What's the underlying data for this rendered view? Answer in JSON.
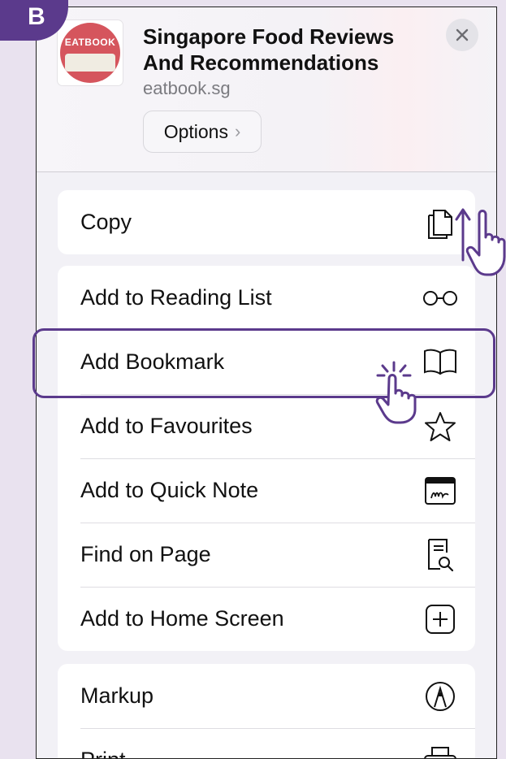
{
  "step_badge": "B",
  "site": {
    "title": "Singapore Food Reviews And Recommendations",
    "domain": "eatbook.sg",
    "logo_text": "EATBOOK",
    "options_label": "Options",
    "options_chevron": "›"
  },
  "groups": [
    {
      "rows": [
        {
          "label": "Copy",
          "icon": "copy-icon"
        }
      ]
    },
    {
      "rows": [
        {
          "label": "Add to Reading List",
          "icon": "glasses-icon"
        },
        {
          "label": "Add Bookmark",
          "icon": "book-icon"
        },
        {
          "label": "Add to Favourites",
          "icon": "star-icon"
        },
        {
          "label": "Add to Quick Note",
          "icon": "quick-note-icon"
        },
        {
          "label": "Find on Page",
          "icon": "find-on-page-icon"
        },
        {
          "label": "Add to Home Screen",
          "icon": "add-square-icon"
        }
      ]
    },
    {
      "rows": [
        {
          "label": "Markup",
          "icon": "markup-pen-icon"
        },
        {
          "label": "Print",
          "icon": "printer-icon"
        }
      ]
    }
  ],
  "colors": {
    "accent": "#5b3a8c",
    "background": "#e9e2ef",
    "logo_red": "#d5555d"
  },
  "annotation_icons": [
    "tap-hand-icon",
    "swipe-up-hand-icon"
  ]
}
